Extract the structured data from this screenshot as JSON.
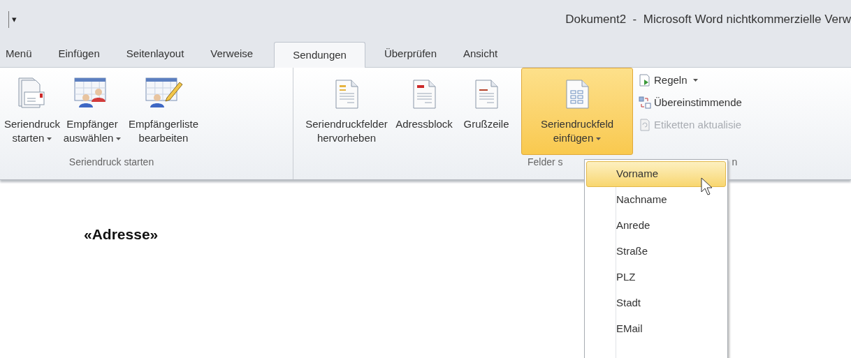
{
  "window": {
    "title": "Dokument2  -  Microsoft Word nichtkommerzielle Verw",
    "quick_access": "▾"
  },
  "tabs": [
    {
      "label": "Menü",
      "selected": false
    },
    {
      "label": "Einfügen",
      "selected": false
    },
    {
      "label": "Seitenlayout",
      "selected": false
    },
    {
      "label": "Verweise",
      "selected": false
    },
    {
      "label": "Sendungen",
      "selected": true
    },
    {
      "label": "Überprüfen",
      "selected": false
    },
    {
      "label": "Ansicht",
      "selected": false
    }
  ],
  "ribbon": {
    "groups": [
      {
        "label_parts": [
          "Seriendruck starten"
        ],
        "buttons": [
          {
            "lines": [
              "Seriendruck",
              "starten"
            ],
            "has_menu": true,
            "selected": false
          },
          {
            "lines": [
              "Empfänger",
              "auswählen"
            ],
            "has_menu": true,
            "selected": false
          },
          {
            "lines": [
              "Empfängerliste",
              "bearbeiten"
            ],
            "has_menu": false,
            "selected": false
          }
        ]
      },
      {
        "label_parts": [
          "Felder s",
          "n"
        ],
        "buttons": [
          {
            "lines": [
              "Seriendruckfelder",
              "hervorheben"
            ],
            "has_menu": false,
            "selected": false
          },
          {
            "lines": [
              "Adressblock"
            ],
            "has_menu": false,
            "selected": false
          },
          {
            "lines": [
              "Grußzeile"
            ],
            "has_menu": false,
            "selected": false
          },
          {
            "lines": [
              "Seriendruckfeld",
              "einfügen"
            ],
            "has_menu": true,
            "selected": true
          }
        ],
        "small_buttons": [
          {
            "label": "Regeln",
            "has_menu": true,
            "disabled": false
          },
          {
            "label": "Übereinstimmende",
            "has_menu": false,
            "disabled": false
          },
          {
            "label": "Etiketten aktualisie",
            "has_menu": false,
            "disabled": true
          }
        ]
      }
    ]
  },
  "dropdown": {
    "items": [
      {
        "label": "Vorname",
        "selected": true
      },
      {
        "label": "Nachname",
        "selected": false
      },
      {
        "label": "Anrede",
        "selected": false
      },
      {
        "label": "Straße",
        "selected": false
      },
      {
        "label": "PLZ",
        "selected": false
      },
      {
        "label": "Stadt",
        "selected": false
      },
      {
        "label": "EMail",
        "selected": false
      }
    ]
  },
  "document": {
    "text": "«Adresse»"
  }
}
